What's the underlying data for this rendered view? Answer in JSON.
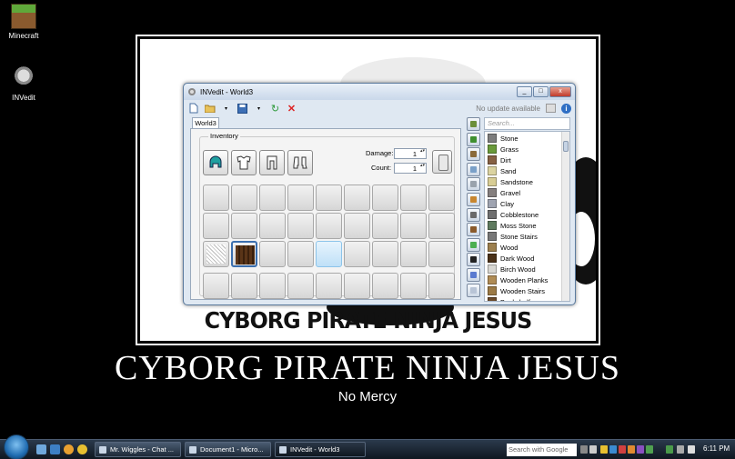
{
  "desktop": {
    "icons": [
      {
        "label": "Minecraft"
      },
      {
        "label": "INVedit"
      }
    ]
  },
  "poster": {
    "impact_caption": "CYBORG PIRATE NINJA JESUS",
    "title": "CYBORG PIRATE NINJA JESUS",
    "subtitle": "No Mercy"
  },
  "window": {
    "title": "INVedit - World3",
    "controls": [
      "_",
      "□",
      "x"
    ],
    "toolbar": {
      "update_text": "No update available",
      "info_glyph": "i"
    },
    "tab": "World3",
    "inventory": {
      "group_label": "Inventory",
      "armor_slots": [
        "helmet-icon",
        "chestplate-icon",
        "leggings-icon",
        "boots-icon"
      ],
      "damage_label": "Damage:",
      "damage_value": "1",
      "count_label": "Count:",
      "count_value": "1",
      "rows": 4,
      "cols": 9,
      "filled_slots": [
        {
          "row": 2,
          "col": 0,
          "item": "Cobweb"
        },
        {
          "row": 2,
          "col": 1,
          "item": "Dark Wood",
          "selected": true
        }
      ],
      "hover_slot": {
        "row": 2,
        "col": 4
      }
    },
    "search_placeholder": "Search...",
    "categories": [
      {
        "icon": "grass-block-icon",
        "color": "#6b8f3a"
      },
      {
        "icon": "sapling-icon",
        "color": "#3f8f2f"
      },
      {
        "icon": "pickaxe-icon",
        "color": "#8a6a3a"
      },
      {
        "icon": "sword-icon",
        "color": "#7aa0c8"
      },
      {
        "icon": "armor-icon",
        "color": "#9aa3ad"
      },
      {
        "icon": "food-icon",
        "color": "#c8862f"
      },
      {
        "icon": "ore-icon",
        "color": "#6a6a6a"
      },
      {
        "icon": "chest-icon",
        "color": "#8a5a2a"
      },
      {
        "icon": "slimeball-icon",
        "color": "#4caf50"
      },
      {
        "icon": "music-disc-icon",
        "color": "#222"
      },
      {
        "icon": "potion-icon",
        "color": "#5a7ad0"
      },
      {
        "icon": "misc-icon",
        "color": "#b8c4d6"
      }
    ],
    "items": [
      {
        "name": "Stone",
        "color": "#7d7d7d"
      },
      {
        "name": "Grass",
        "color": "#6a9a3a"
      },
      {
        "name": "Dirt",
        "color": "#866043"
      },
      {
        "name": "Sand",
        "color": "#dbd3a0"
      },
      {
        "name": "Sandstone",
        "color": "#d8cd94"
      },
      {
        "name": "Gravel",
        "color": "#857f7e"
      },
      {
        "name": "Clay",
        "color": "#9fa4b1"
      },
      {
        "name": "Cobblestone",
        "color": "#6f6f6f"
      },
      {
        "name": "Moss Stone",
        "color": "#5e7a5e"
      },
      {
        "name": "Stone Stairs",
        "color": "#777777"
      },
      {
        "name": "Wood",
        "color": "#9c7f4e"
      },
      {
        "name": "Dark Wood",
        "color": "#4a3118"
      },
      {
        "name": "Birch Wood",
        "color": "#d8d7d2"
      },
      {
        "name": "Wooden Planks",
        "color": "#b08c55"
      },
      {
        "name": "Wooden Stairs",
        "color": "#9c7a45"
      },
      {
        "name": "Bookshelf",
        "color": "#6b4a2a"
      }
    ]
  },
  "taskbar": {
    "tasks": [
      {
        "label": "Mr. Wiggles - Chat ..."
      },
      {
        "label": "Document1 - Micro..."
      },
      {
        "label": "INVedit - World3"
      }
    ],
    "search_placeholder": "Search with Google",
    "clock": "6:11 PM"
  }
}
